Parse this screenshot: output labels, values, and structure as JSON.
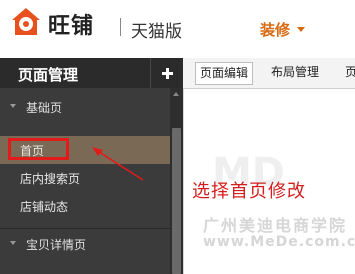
{
  "header": {
    "brand": "旺铺",
    "edition": "天猫版",
    "decorate_label": "装修"
  },
  "sidebar": {
    "title": "页面管理",
    "groups": [
      {
        "label": "基础页"
      },
      {
        "label": "宝贝详情页"
      }
    ],
    "items": [
      {
        "label": "首页"
      },
      {
        "label": "店内搜索页"
      },
      {
        "label": "店铺动态"
      }
    ]
  },
  "tabs": [
    {
      "label": "页面编辑"
    },
    {
      "label": "布局管理"
    },
    {
      "label": "页"
    }
  ],
  "annotation": {
    "text": "选择首页修改"
  },
  "watermark": {
    "mark": "MD",
    "line1": "广州美迪电商学院",
    "line2": "www.MeDe.com.cn"
  },
  "colors": {
    "accent": "#d86a12",
    "annotation_red": "#e21a1a",
    "sidebar_bg": "#3b3b3b",
    "active_item_bg": "#7a6a55"
  }
}
